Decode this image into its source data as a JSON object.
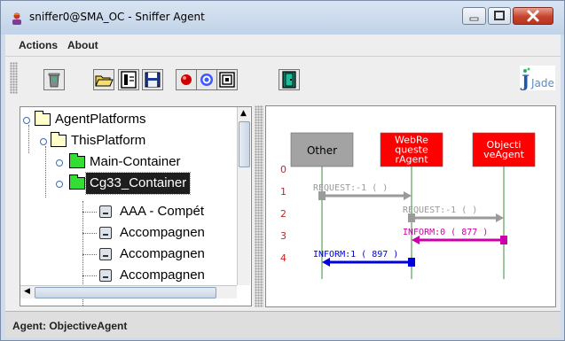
{
  "window": {
    "title": "sniffer0@SMA_OC - Sniffer Agent",
    "icon": "jade-agent-icon"
  },
  "menubar": {
    "items": [
      {
        "label": "Actions"
      },
      {
        "label": "About"
      }
    ]
  },
  "toolbar": {
    "buttons": [
      {
        "icon": "recycle-bin-icon"
      },
      {
        "icon": "open-folder-icon"
      },
      {
        "icon": "open-file-icon"
      },
      {
        "icon": "save-icon"
      },
      {
        "icon": "record-red-icon"
      },
      {
        "icon": "swirl-icon"
      },
      {
        "icon": "monitor-icon"
      },
      {
        "icon": "exit-door-icon"
      }
    ],
    "logo_text": "Jade"
  },
  "tree": {
    "nodes": [
      {
        "label": "AgentPlatforms",
        "type": "folder",
        "level": 0,
        "color": "#ffffcc"
      },
      {
        "label": "ThisPlatform",
        "type": "folder",
        "level": 1,
        "color": "#ffffcc"
      },
      {
        "label": "Main-Container",
        "type": "folder",
        "level": 2,
        "color": "#33dd33"
      },
      {
        "label": "Cg33_Container",
        "type": "folder",
        "level": 2,
        "color": "#33dd33",
        "selected": true
      },
      {
        "label": "AAA - Compét",
        "type": "agent",
        "level": 3
      },
      {
        "label": "Accompagnen",
        "type": "agent",
        "level": 3
      },
      {
        "label": "Accompagnen",
        "type": "agent",
        "level": 3
      },
      {
        "label": "Accompagnen",
        "type": "agent",
        "level": 3
      }
    ]
  },
  "sniffer": {
    "agents": [
      {
        "name": "Other",
        "lines": [
          "Other"
        ],
        "color": "#a3a3a3",
        "text_color": "#000000"
      },
      {
        "name": "WebRequesterAgent",
        "lines": [
          "WebRe",
          "queste",
          "rAgent"
        ],
        "color": "#ff0000",
        "text_color": "#ffffff"
      },
      {
        "name": "ObjectiveAgent",
        "lines": [
          "Objecti",
          "veAgent"
        ],
        "color": "#ff0000",
        "text_color": "#ffffff"
      }
    ],
    "row_numbers": [
      "0",
      "1",
      "2",
      "3",
      "4"
    ],
    "messages": [
      {
        "row": 1,
        "from": 0,
        "to": 1,
        "label": "REQUEST:-1 (     )",
        "color": "#9a9a9a"
      },
      {
        "row": 2,
        "from": 1,
        "to": 2,
        "label": "REQUEST:-1 (     )",
        "color": "#9a9a9a"
      },
      {
        "row": 3,
        "from": 2,
        "to": 1,
        "label": "INFORM:0 (  877   )",
        "color": "#cc00aa"
      },
      {
        "row": 4,
        "from": 1,
        "to": 0,
        "label": "INFORM:1 (  897   )",
        "color": "#0000dd"
      }
    ]
  },
  "status": {
    "text": "Agent: ObjectiveAgent"
  }
}
